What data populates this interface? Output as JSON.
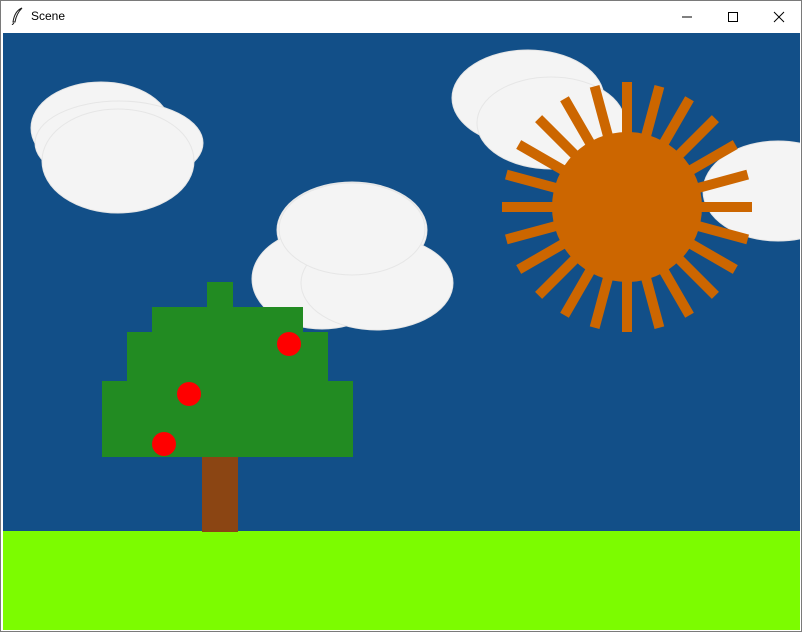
{
  "window": {
    "title": "Scene",
    "controls": [
      "minimize",
      "maximize",
      "close"
    ]
  },
  "icons": {
    "app": "feather-icon",
    "minimize": "minimize-icon",
    "maximize": "maximize-icon",
    "close": "close-icon"
  },
  "scene": {
    "colors": {
      "sky": "#124f88",
      "grass": "#7cfc00",
      "cloud": "#f4f4f4",
      "cloud_edge": "#e6e6e6",
      "sun": "#cc6600",
      "leaves": "#228b22",
      "trunk": "#8b4513",
      "apple": "#ff0000"
    },
    "sun_rays": 24,
    "apples": 3,
    "clouds": 4
  }
}
